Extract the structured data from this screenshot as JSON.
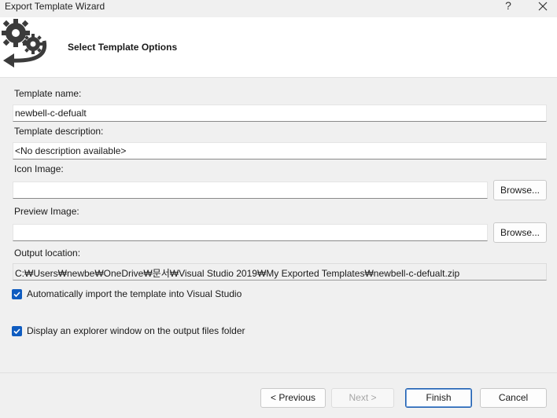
{
  "window": {
    "title": "Export Template Wizard",
    "help_glyph": "?",
    "close_glyph": "close"
  },
  "header": {
    "heading": "Select Template Options",
    "logo_icon": "gears-export-icon"
  },
  "form": {
    "template_name": {
      "label": "Template name:",
      "value": "newbell-c-defualt"
    },
    "template_description": {
      "label": "Template description:",
      "value": "<No description available>"
    },
    "icon_image": {
      "label": "Icon Image:",
      "value": "",
      "browse_label": "Browse..."
    },
    "preview_image": {
      "label": "Preview Image:",
      "value": "",
      "browse_label": "Browse..."
    },
    "output_location": {
      "label": "Output location:",
      "value": "C:₩Users₩newbe₩OneDrive₩문서₩Visual Studio 2019₩My Exported Templates₩newbell-c-defualt.zip"
    },
    "auto_import": {
      "label": "Automatically import the template into Visual Studio",
      "checked": true
    },
    "display_explorer": {
      "label": "Display an explorer window on the output files folder",
      "checked": true
    }
  },
  "buttons": {
    "previous": "< Previous",
    "next": "Next >",
    "finish": "Finish",
    "cancel": "Cancel"
  },
  "colors": {
    "accent": "#0f5cc0",
    "default_button_border": "#1f5fb0",
    "background": "#f0f0f0"
  }
}
